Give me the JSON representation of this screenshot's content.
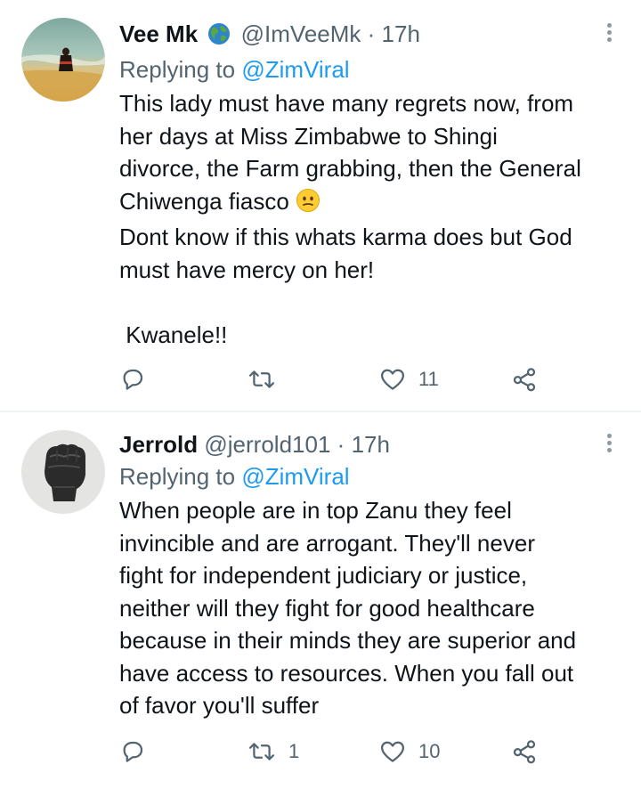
{
  "tweets": [
    {
      "display_name": "Vee Mk",
      "handle": "@ImVeeMk",
      "separator": "·",
      "time": "17h",
      "replying_prefix": "Replying to",
      "replying_to": "@ZimViral",
      "body_lines": [
        "This lady must have many regrets now, from",
        "her days at Miss Zimbabwe to Shingi",
        "divorce, the Farm grabbing, then the General",
        "Chiwenga fiasco",
        "Dont know if this whats karma does but God",
        "must have mercy on her!",
        "",
        " Kwanele!!"
      ],
      "reply_count": "",
      "retweet_count": "",
      "like_count": "11",
      "avatar_icon": "beach-photo-avatar",
      "badge_icon": "globe-emoji-icon",
      "emoji_icon": "neutral-face-emoji"
    },
    {
      "display_name": "Jerrold",
      "handle": "@jerrold101",
      "separator": "·",
      "time": "17h",
      "replying_prefix": "Replying to",
      "replying_to": "@ZimViral",
      "body_lines": [
        "When people are in top Zanu they feel",
        "invincible and are arrogant. They'll never",
        "fight for independent judiciary or justice,",
        "neither will they fight for good healthcare",
        "because in their minds they are superior and",
        "have access to resources. When you fall out",
        "of favor you'll suffer"
      ],
      "reply_count": "",
      "retweet_count": "1",
      "like_count": "10",
      "avatar_icon": "raised-fist-avatar"
    }
  ],
  "colors": {
    "text": "#0f1419",
    "muted": "#536471",
    "link": "#1d9bf0",
    "divider": "#eff3f4"
  }
}
